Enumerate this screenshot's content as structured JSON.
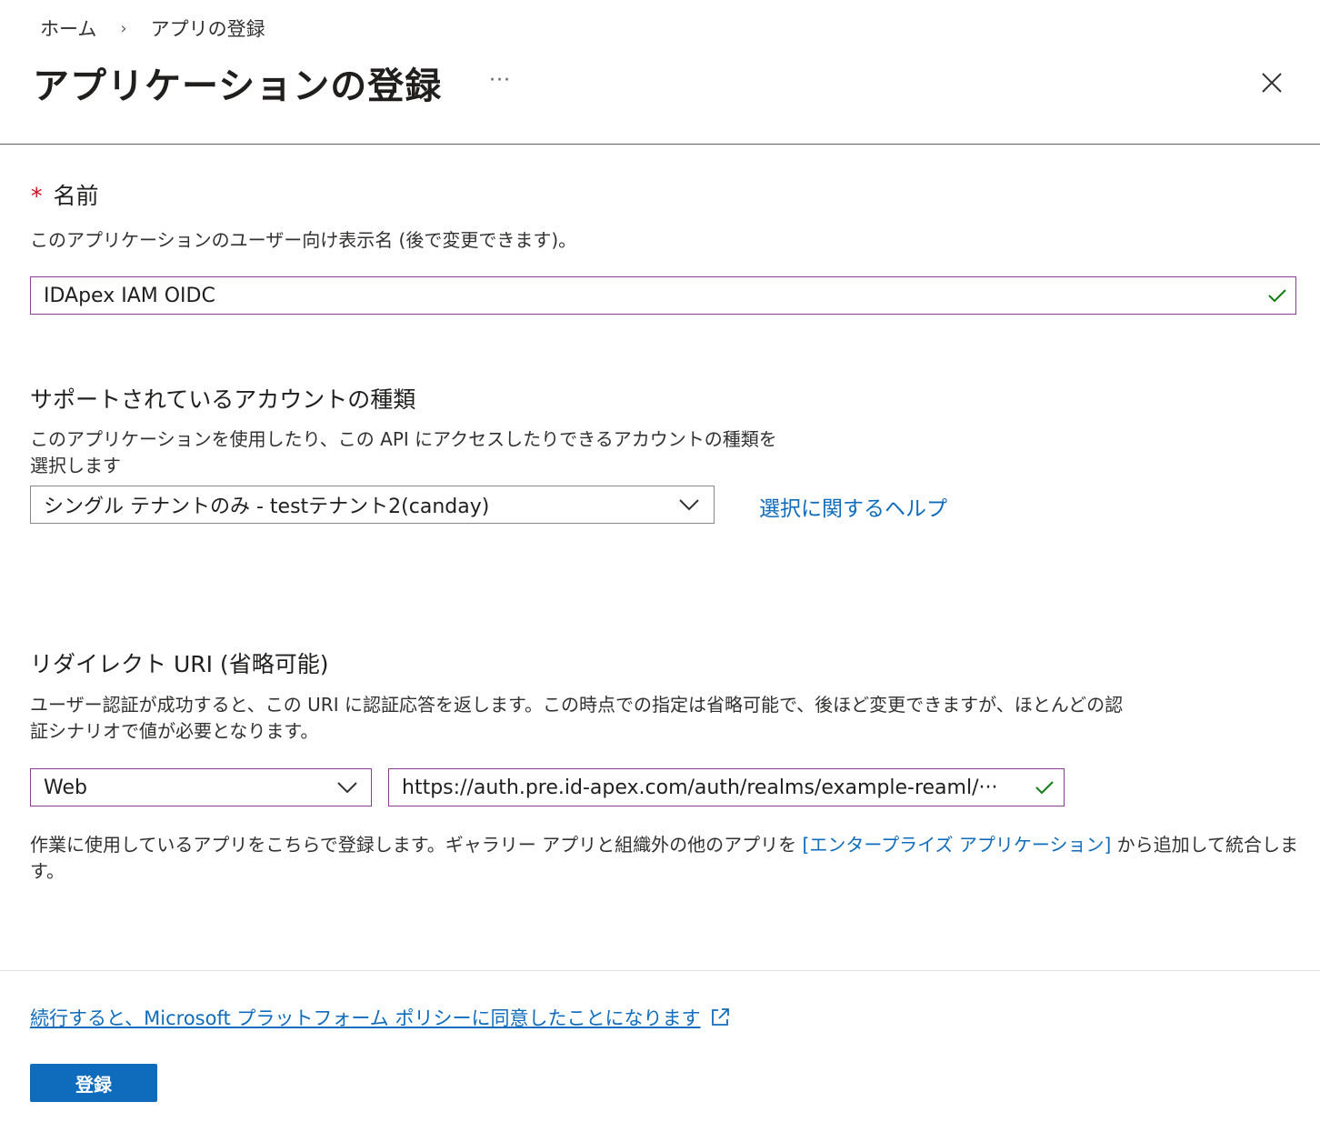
{
  "breadcrumb": {
    "home": "ホーム",
    "separator": "›",
    "current": "アプリの登録"
  },
  "header": {
    "title": "アプリケーションの登録",
    "more": "···"
  },
  "name_section": {
    "label": "名前",
    "required_mark": "*",
    "description": "このアプリケーションのユーザー向け表示名 (後で変更できます)。",
    "value": "IDApex IAM OIDC"
  },
  "account_section": {
    "title": "サポートされているアカウントの種類",
    "description_line1": "このアプリケーションを使用したり、この API にアクセスしたりできるアカウントの種類を",
    "description_line2": "選択します",
    "selected": "シングル テナントのみ - testテナント2(canday)",
    "help_link": "選択に関するヘルプ"
  },
  "redirect_section": {
    "title": "リダイレクト URI (省略可能)",
    "description_line1": "ユーザー認証が成功すると、この URI に認証応答を返します。この時点での指定は省略可能で、後ほど変更できますが、ほとんどの認",
    "description_line2": "証シナリオで値が必要となります。",
    "platform": "Web",
    "uri": "https://auth.pre.id-apex.com/auth/realms/example-reaml/···"
  },
  "enterprise_note": {
    "before": "作業に使用しているアプリをこちらで登録します。ギャラリー アプリと組織外の他のアプリを ",
    "link": "[エンタープライズ アプリケーション]",
    "after": " から追加して統合します。"
  },
  "footer": {
    "policy_text": "続行すると、Microsoft プラットフォーム ポリシーに同意したことになります",
    "register_label": "登録"
  },
  "colors": {
    "accent": "#0f6cbd",
    "required": "#c50f1f",
    "focus_border": "#8a3e8f",
    "valid_check": "#107c10"
  }
}
